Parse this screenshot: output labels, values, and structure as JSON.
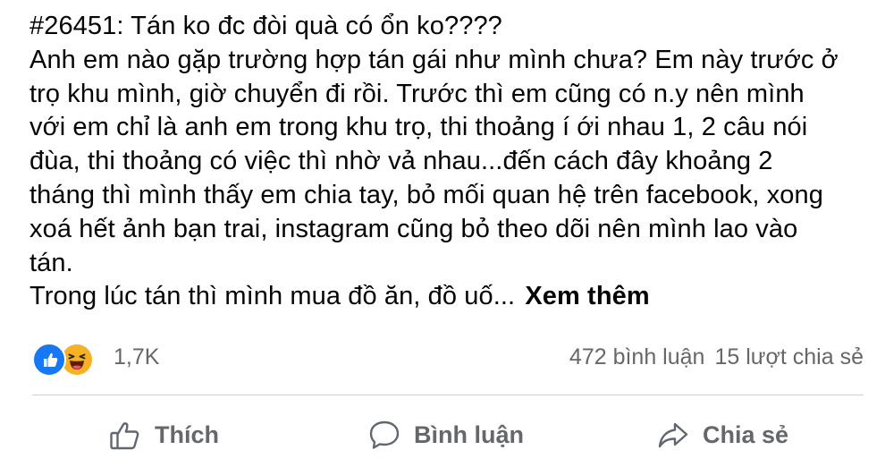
{
  "post": {
    "lines": [
      "#26451: Tán ko đc đòi quà có ổn ko????",
      "Anh em nào gặp trường hợp tán gái như mình chưa? Em này trước ở",
      "trọ khu mình, giờ chuyển đi rồi. Trước thì em cũng có n.y nên mình",
      "với em chỉ là anh em trong khu trọ, thi thoảng í ới nhau 1, 2 câu nói",
      "đùa, thi thoảng có việc thì nhờ vả nhau...đến cách đây khoảng 2",
      "tháng thì mình thấy em chia tay, bỏ mối quan hệ trên facebook, xong",
      "xoá hết ảnh bạn trai, instagram cũng bỏ theo dõi nên mình lao vào",
      "tán.",
      "Trong lúc tán thì mình mua đồ ăn, đồ uố..."
    ],
    "see_more": "Xem thêm"
  },
  "stats": {
    "reaction_count": "1,7K",
    "comments": "472 bình luận",
    "shares": "15 lượt chia sẻ",
    "reactions": [
      "like-icon",
      "haha-icon"
    ]
  },
  "actions": {
    "like": "Thích",
    "comment": "Bình luận",
    "share": "Chia sẻ"
  },
  "colors": {
    "text": "#050505",
    "secondary": "#65676b",
    "like_blue": "#1877f2",
    "haha_yellow": "#f7b125",
    "divider": "#ced0d4"
  }
}
